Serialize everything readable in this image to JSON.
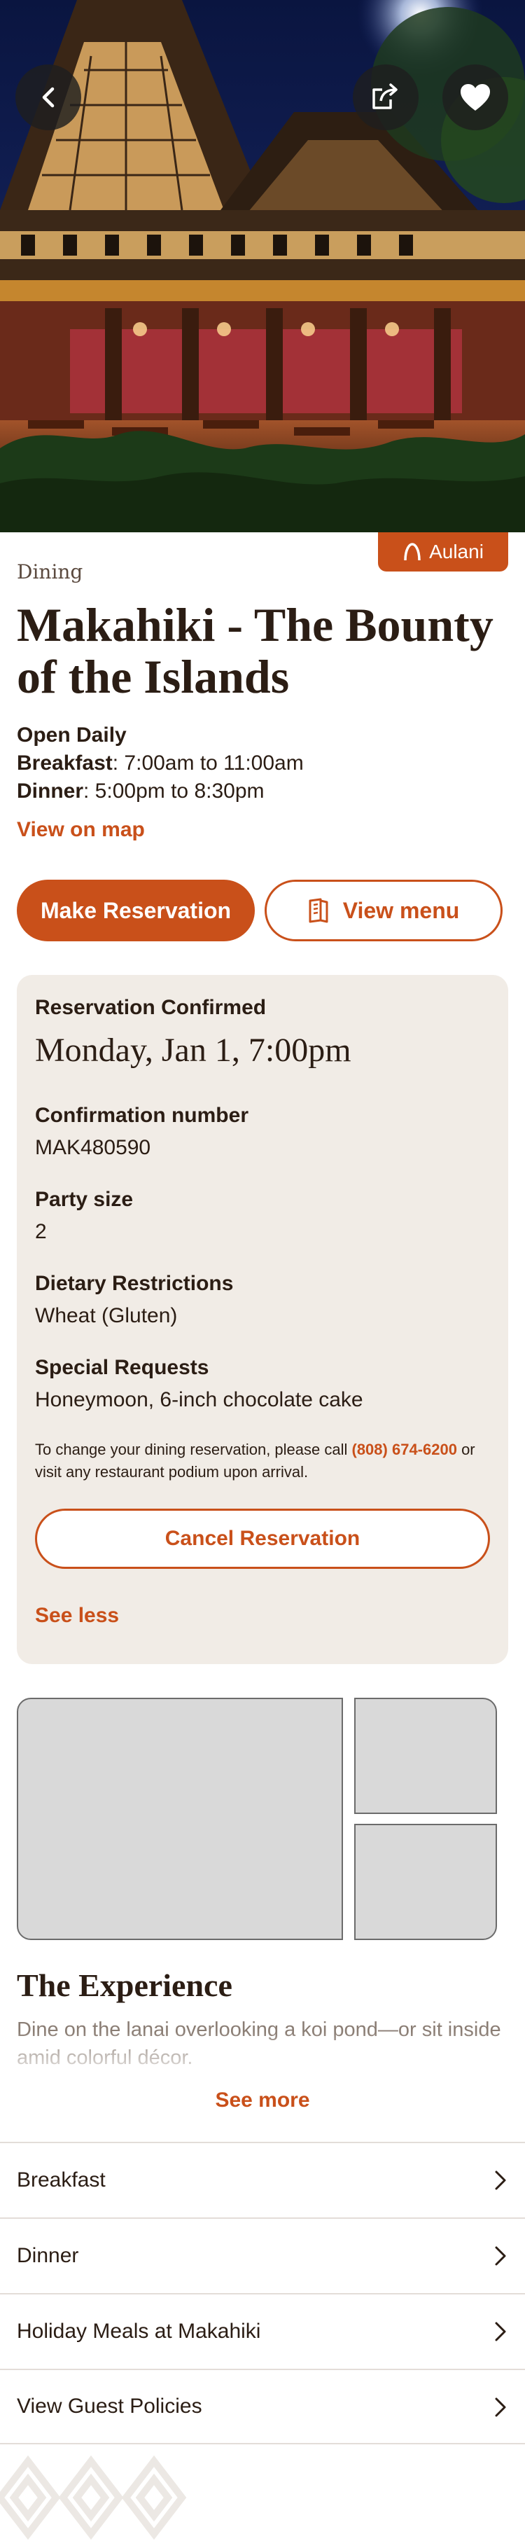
{
  "header": {
    "back_icon": "chevron-left-icon",
    "share_icon": "share-icon",
    "favorite_icon": "heart-icon",
    "resort_badge": "Aulani"
  },
  "restaurant": {
    "category": "Dining",
    "name": "Makahiki - The Bounty of the Islands",
    "hours": {
      "title": "Open Daily",
      "breakfast_label": "Breakfast",
      "breakfast_hours": ": 7:00am to 11:00am",
      "dinner_label": "Dinner",
      "dinner_hours": ": 5:00pm to 8:30pm"
    },
    "map_link": "View on map"
  },
  "actions": {
    "reserve": "Make Reservation",
    "menu": "View menu"
  },
  "reservation": {
    "status": "Reservation Confirmed",
    "date": "Monday, Jan 1, 7:00pm",
    "confirmation_label": "Confirmation number",
    "confirmation_value": "MAK480590",
    "party_label": "Party size",
    "party_value": "2",
    "dietary_label": "Dietary Restrictions",
    "dietary_value": "Wheat (Gluten)",
    "requests_label": "Special Requests",
    "requests_value": "Honeymoon, 6-inch chocolate cake",
    "note_prefix": "To change your dining reservation, please call ",
    "note_phone": "(808) 674-6200",
    "note_suffix": " or visit any restaurant podium upon arrival.",
    "cancel": "Cancel Reservation",
    "see_less": "See less"
  },
  "experience": {
    "title": "The Experience",
    "description": "Dine on the lanai overlooking a koi pond—or sit inside amid colorful décor.",
    "see_more": "See more"
  },
  "list": [
    {
      "label": "Breakfast"
    },
    {
      "label": "Dinner"
    },
    {
      "label": "Holiday Meals at Makahiki"
    },
    {
      "label": "View Guest Policies"
    }
  ],
  "colors": {
    "accent": "#c9501a",
    "card_bg": "#f1ece6",
    "text": "#2b1d14"
  }
}
